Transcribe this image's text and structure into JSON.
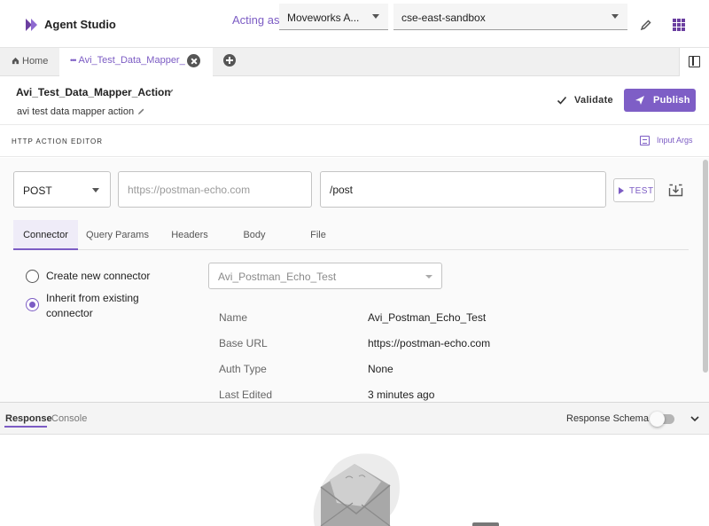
{
  "app": {
    "title": "Agent Studio",
    "logo_icon": "agent-studio-logo-icon",
    "brand_color": "#7e5ec6"
  },
  "topbar": {
    "acting_as_label": "Acting as:",
    "org_select": "Moveworks A...",
    "env_select": "cse-east-sandbox",
    "icons": [
      "pencil-icon",
      "apps-grid-icon"
    ]
  },
  "tabs": {
    "home_label": "Home",
    "active_label": "Avi_Test_Data_Mapper_",
    "icons": [
      "home-icon",
      "close-icon",
      "add-icon",
      "panel-toggle-icon"
    ]
  },
  "header": {
    "action_name": "Avi_Test_Data_Mapper_Action",
    "description": "avi test data mapper action",
    "validate_label": "Validate",
    "publish_label": "Publish"
  },
  "editor": {
    "section_title": "HTTP ACTION EDITOR",
    "input_args_label": "Input Args",
    "method": "POST",
    "base_url_placeholder": "https://postman-echo.com",
    "path": "/post",
    "test_label": "TEST",
    "tabs": [
      "Connector",
      "Query Params",
      "Headers",
      "Body",
      "File"
    ],
    "active_tab": "Connector"
  },
  "connector": {
    "option_create": "Create new connector",
    "option_inherit": "Inherit from existing connector",
    "selected_option": "inherit",
    "selected_connector": "Avi_Postman_Echo_Test",
    "details": [
      {
        "key": "Name",
        "value": "Avi_Postman_Echo_Test"
      },
      {
        "key": "Base URL",
        "value": "https://postman-echo.com"
      },
      {
        "key": "Auth Type",
        "value": "None"
      },
      {
        "key": "Last Edited",
        "value": "3 minutes ago"
      }
    ]
  },
  "bottom": {
    "tabs": [
      "Response",
      "Console"
    ],
    "active_tab": "Response",
    "schema_label": "Response Schema",
    "schema_toggle": false
  }
}
